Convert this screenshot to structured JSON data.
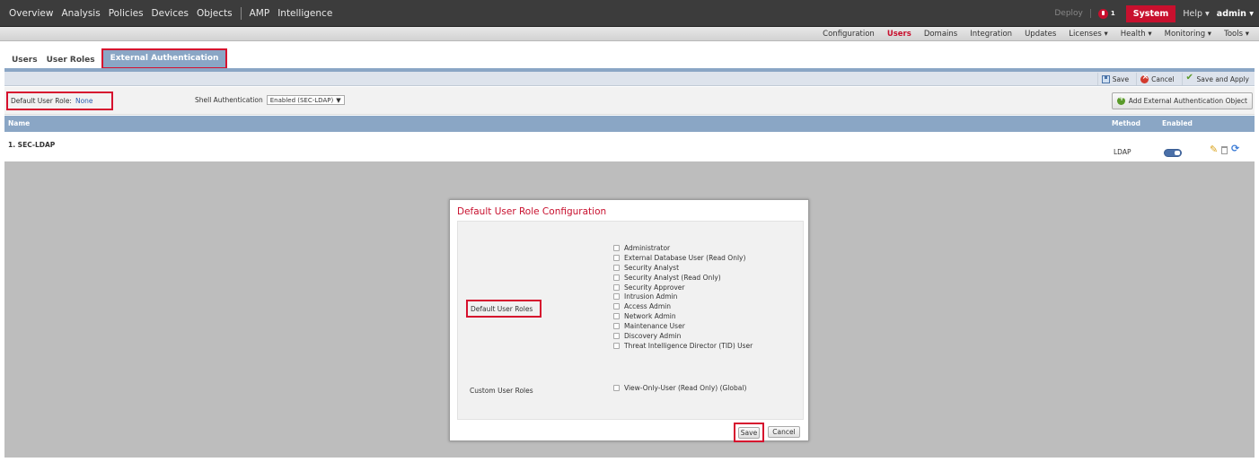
{
  "topnav": {
    "items": [
      "Overview",
      "Analysis",
      "Policies",
      "Devices",
      "Objects",
      "AMP",
      "Intelligence"
    ],
    "deploy": "Deploy",
    "alert_count": "1",
    "system": "System",
    "help": "Help ▾",
    "admin": "admin ▾"
  },
  "subnav": {
    "items": [
      "Configuration",
      "Users",
      "Domains",
      "Integration",
      "Updates",
      "Licenses ▾",
      "Health ▾",
      "Monitoring ▾",
      "Tools ▾"
    ],
    "active": "Users"
  },
  "tabs": {
    "users": "Users",
    "user_roles": "User Roles",
    "external_auth": "External Authentication"
  },
  "toolbar": {
    "save": "Save",
    "cancel": "Cancel",
    "save_apply": "Save and Apply"
  },
  "config": {
    "default_role_label": "Default User Role:",
    "default_role_value": "None",
    "shell_label": "Shell Authentication",
    "shell_value": "Enabled (SEC-LDAP)",
    "add_button": "Add External Authentication Object"
  },
  "table": {
    "col_name": "Name",
    "col_method": "Method",
    "col_enabled": "Enabled",
    "rows": [
      {
        "name": "1. SEC-LDAP",
        "method": "LDAP",
        "enabled": true
      }
    ]
  },
  "modal": {
    "title": "Default User Role Configuration",
    "default_roles_label": "Default User Roles",
    "roles": [
      "Administrator",
      "External Database User (Read Only)",
      "Security Analyst",
      "Security Analyst (Read Only)",
      "Security Approver",
      "Intrusion Admin",
      "Access Admin",
      "Network Admin",
      "Maintenance User",
      "Discovery Admin",
      "Threat Intelligence Director (TID) User"
    ],
    "custom_roles_label": "Custom User Roles",
    "custom_roles": [
      "View-Only-User (Read Only) (Global)"
    ],
    "save": "Save",
    "cancel": "Cancel"
  }
}
